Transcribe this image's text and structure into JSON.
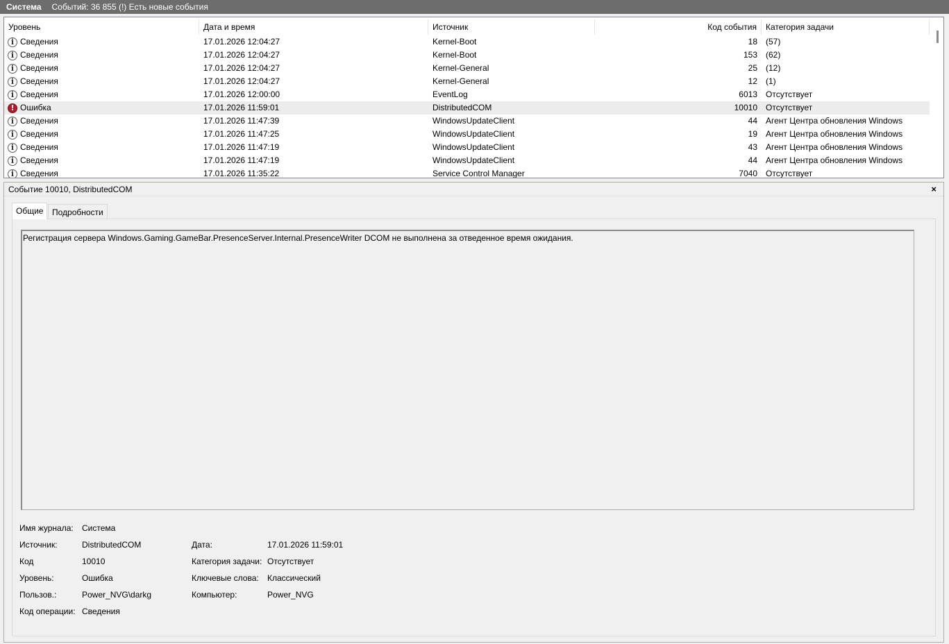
{
  "titlebar": {
    "log_name": "Система",
    "info": "Событий: 36 855 (!) Есть новые события"
  },
  "columns": {
    "level": "Уровень",
    "date": "Дата и время",
    "source": "Источник",
    "code": "Код события",
    "category": "Категория задачи"
  },
  "events": [
    {
      "level": "Сведения",
      "type": "info",
      "date": "17.01.2026 12:04:27",
      "source": "Kernel-Boot",
      "code": "18",
      "category": "(57)"
    },
    {
      "level": "Сведения",
      "type": "info",
      "date": "17.01.2026 12:04:27",
      "source": "Kernel-Boot",
      "code": "153",
      "category": "(62)"
    },
    {
      "level": "Сведения",
      "type": "info",
      "date": "17.01.2026 12:04:27",
      "source": "Kernel-General",
      "code": "25",
      "category": "(12)"
    },
    {
      "level": "Сведения",
      "type": "info",
      "date": "17.01.2026 12:04:27",
      "source": "Kernel-General",
      "code": "12",
      "category": "(1)"
    },
    {
      "level": "Сведения",
      "type": "info",
      "date": "17.01.2026 12:00:00",
      "source": "EventLog",
      "code": "6013",
      "category": "Отсутствует"
    },
    {
      "level": "Ошибка",
      "type": "error",
      "date": "17.01.2026 11:59:01",
      "source": "DistributedCOM",
      "code": "10010",
      "category": "Отсутствует",
      "selected": true
    },
    {
      "level": "Сведения",
      "type": "info",
      "date": "17.01.2026 11:47:39",
      "source": "WindowsUpdateClient",
      "code": "44",
      "category": "Агент Центра обновления Windows"
    },
    {
      "level": "Сведения",
      "type": "info",
      "date": "17.01.2026 11:47:25",
      "source": "WindowsUpdateClient",
      "code": "19",
      "category": "Агент Центра обновления Windows"
    },
    {
      "level": "Сведения",
      "type": "info",
      "date": "17.01.2026 11:47:19",
      "source": "WindowsUpdateClient",
      "code": "43",
      "category": "Агент Центра обновления Windows"
    },
    {
      "level": "Сведения",
      "type": "info",
      "date": "17.01.2026 11:47:19",
      "source": "WindowsUpdateClient",
      "code": "44",
      "category": "Агент Центра обновления Windows"
    },
    {
      "level": "Сведения",
      "type": "info",
      "date": "17.01.2026 11:35:22",
      "source": "Service Control Manager",
      "code": "7040",
      "category": "Отсутствует"
    }
  ],
  "detail": {
    "header": "Событие 10010, DistributedCOM",
    "close": "×",
    "tabs": [
      "Общие",
      "Подробности"
    ],
    "message": "Регистрация сервера Windows.Gaming.GameBar.PresenceServer.Internal.PresenceWriter DCOM не выполнена за отведенное время ожидания.",
    "props": {
      "log_label": "Имя журнала:",
      "log_value": "Система",
      "source_label": "Источник:",
      "source_value": "DistributedCOM",
      "date_label": "Дата:",
      "date_value": "17.01.2026 11:59:01",
      "code_label": "Код",
      "code_value": "10010",
      "category_label": "Категория задачи:",
      "category_value": "Отсутствует",
      "level_label": "Уровень:",
      "level_value": "Ошибка",
      "keywords_label": "Ключевые слова:",
      "keywords_value": "Классический",
      "user_label": "Пользов.:",
      "user_value": "Power_NVG\\darkg",
      "computer_label": "Компьютер:",
      "computer_value": "Power_NVG",
      "opcode_label": "Код операции:",
      "opcode_value": "Сведения"
    }
  },
  "colors": {
    "titlebar_bg": "#6d6d6d",
    "error_icon": "#b11a2b",
    "selected_row": "#ececec"
  }
}
